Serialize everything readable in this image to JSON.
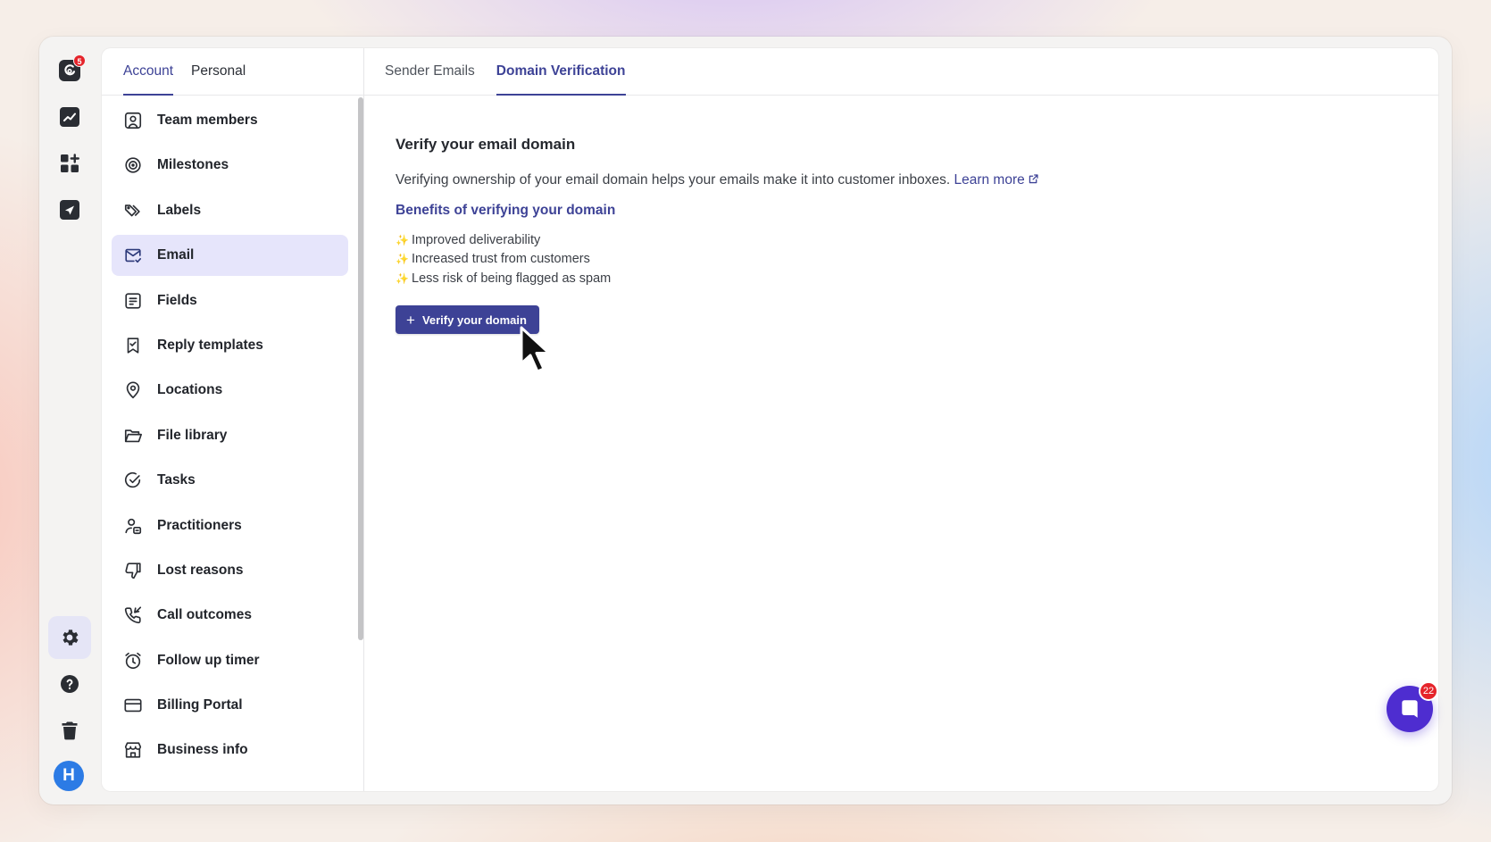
{
  "rail": {
    "logo_badge": "5",
    "avatar_initial": "H"
  },
  "settings_tabs": [
    {
      "label": "Account",
      "active": true
    },
    {
      "label": "Personal",
      "active": false
    }
  ],
  "nav": {
    "items": [
      {
        "label": "Team members",
        "icon": "user-square-icon"
      },
      {
        "label": "Milestones",
        "icon": "target-icon"
      },
      {
        "label": "Labels",
        "icon": "tags-icon"
      },
      {
        "label": "Email",
        "icon": "mail-check-icon",
        "active": true
      },
      {
        "label": "Fields",
        "icon": "form-icon"
      },
      {
        "label": "Reply templates",
        "icon": "bookmark-check-icon"
      },
      {
        "label": "Locations",
        "icon": "map-pin-icon"
      },
      {
        "label": "File library",
        "icon": "folder-open-icon"
      },
      {
        "label": "Tasks",
        "icon": "check-circle-icon"
      },
      {
        "label": "Practitioners",
        "icon": "user-badge-icon"
      },
      {
        "label": "Lost reasons",
        "icon": "thumbs-down-icon"
      },
      {
        "label": "Call outcomes",
        "icon": "phone-outgoing-icon"
      },
      {
        "label": "Follow up timer",
        "icon": "alarm-clock-icon"
      },
      {
        "label": "Billing Portal",
        "icon": "credit-card-icon"
      },
      {
        "label": "Business info",
        "icon": "store-icon"
      }
    ]
  },
  "content_tabs": [
    {
      "label": "Sender Emails",
      "active": false
    },
    {
      "label": "Domain Verification",
      "active": true
    }
  ],
  "content": {
    "heading": "Verify your email domain",
    "description": "Verifying ownership of your email domain helps your emails make it into customer inboxes.",
    "learn_more": "Learn more",
    "benefits_title": "Benefits of verifying your domain",
    "benefits": [
      "Improved deliverability",
      "Increased trust from customers",
      "Less risk of being flagged as spam"
    ],
    "sparkle": "✨",
    "verify_button": "Verify your domain"
  },
  "chat": {
    "badge": "22"
  },
  "colors": {
    "accent": "#3d4296",
    "active_nav_bg": "#e6e5fb",
    "chat": "#4e2dd0",
    "badge": "#e5242b",
    "avatar": "#2c7be5"
  }
}
